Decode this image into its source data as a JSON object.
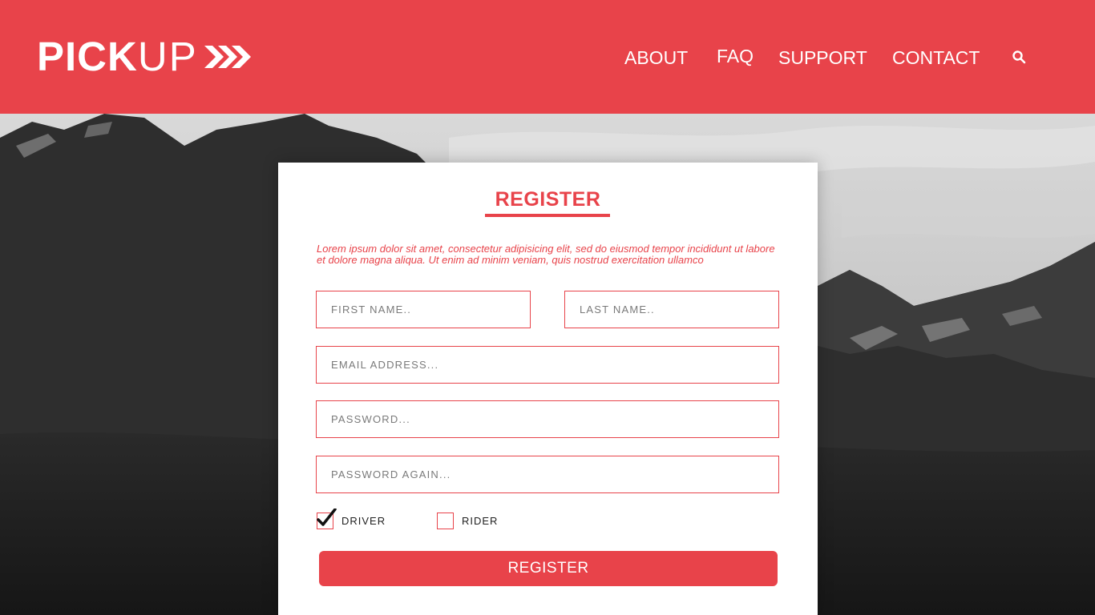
{
  "header": {
    "logo": {
      "bold": "PICK",
      "light": "UP"
    },
    "nav": {
      "about": "ABOUT",
      "faq": "FAQ",
      "support": "SUPPORT",
      "contact": "CONTACT"
    },
    "search_icon": "search-icon"
  },
  "form": {
    "title": "REGISTER",
    "intro": "Lorem ipsum dolor sit amet, consectetur adipisicing elit, sed do eiusmod tempor incididunt ut labore et dolore magna aliqua. Ut enim ad minim veniam, quis nostrud exercitation ullamco",
    "first_name": {
      "placeholder": "FIRST NAME..",
      "value": ""
    },
    "last_name": {
      "placeholder": "LAST NAME..",
      "value": ""
    },
    "email": {
      "placeholder": "EMAIL ADDRESS...",
      "value": ""
    },
    "password": {
      "placeholder": "PASSWORD...",
      "value": ""
    },
    "password_again": {
      "placeholder": "PASSWORD AGAIN...",
      "value": ""
    },
    "role_options": [
      {
        "label": "DRIVER",
        "checked": true
      },
      {
        "label": "RIDER",
        "checked": false
      }
    ],
    "submit_label": "REGISTER"
  },
  "colors": {
    "accent": "#e8434a",
    "text_on_accent": "#ffffff"
  }
}
